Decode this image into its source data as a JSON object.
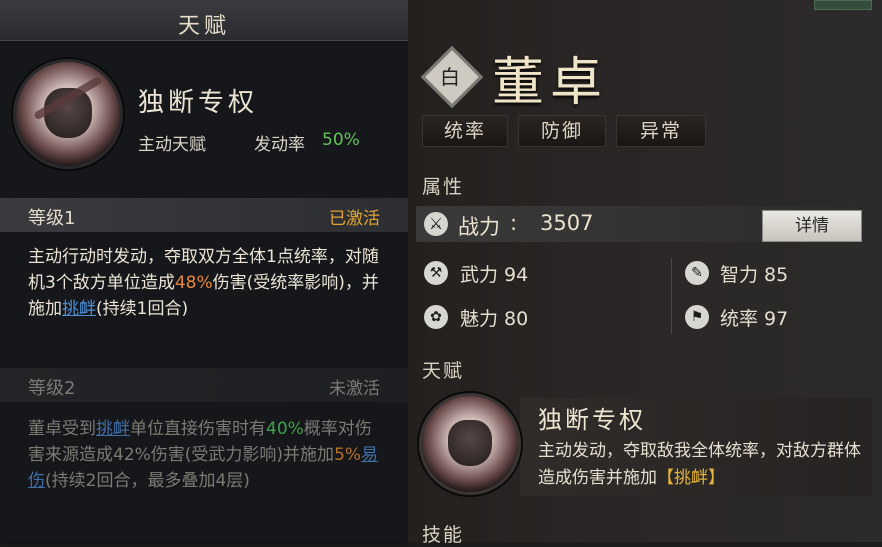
{
  "tooltip": {
    "title": "天赋",
    "talent_name": "独断专权",
    "talent_type": "主动天赋",
    "trigger_rate_label": "发动率",
    "trigger_rate": "50%",
    "level1": {
      "label": "等级1",
      "status": "已激活",
      "desc_a": "主动行动时发动，夺取双方全体1点统率，对随机3个敌方单位造成",
      "desc_pct": "48%",
      "desc_b": "伤害(受统率影响)，并施加",
      "desc_link": "挑衅",
      "desc_c": "(持续1回合)"
    },
    "level2": {
      "label": "等级2",
      "status": "未激活",
      "desc_a": "董卓受到",
      "desc_link1": "挑衅",
      "desc_b": "单位直接伤害时有",
      "desc_pct1": "40%",
      "desc_c": "概率对伤害来源造成42%伤害(受武力影响)并施加",
      "desc_pct2": "5%",
      "desc_link2": "易伤",
      "desc_d": "(持续2回合，最多叠加4层)"
    }
  },
  "general": {
    "rank": "白",
    "name": "董卓",
    "tags": [
      "统率",
      "防御",
      "异常"
    ],
    "attr_section": "属性",
    "power_label": "战力",
    "power_colon": ":",
    "power_value": "3507",
    "detail_button": "详情",
    "stats": {
      "force": "武力 94",
      "intellect": "智力 85",
      "charm": "魅力 80",
      "command": "统率 97"
    },
    "talent_section": "天赋",
    "talent_name": "独断专权",
    "talent_desc": "主动发动，夺取敌我全体统率，对敌方群体造成伤害并施加",
    "talent_tag": "【挑衅】",
    "skill_section": "技能"
  }
}
